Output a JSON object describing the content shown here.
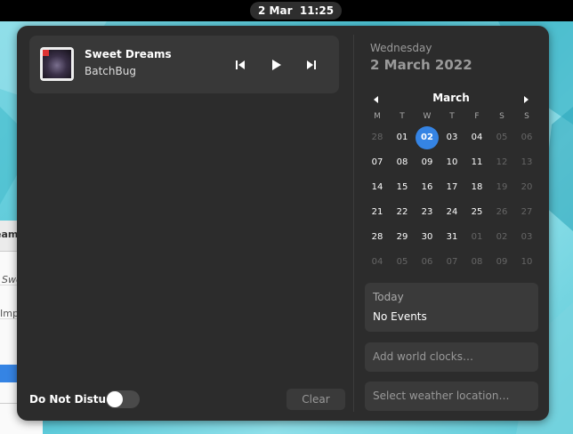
{
  "topbar": {
    "date": "2 Mar",
    "time": "11:25"
  },
  "background_window": {
    "fragments": [
      "eam",
      "Swe",
      "Imp"
    ]
  },
  "media": {
    "title": "Sweet Dreams",
    "artist": "BatchBug"
  },
  "notifications": {
    "dnd_label": "Do Not Disturb",
    "dnd_enabled": false,
    "clear_label": "Clear"
  },
  "calendar": {
    "weekday": "Wednesday",
    "full_date": "2 March 2022",
    "month": "March",
    "day_headers": [
      "M",
      "T",
      "W",
      "T",
      "F",
      "S",
      "S"
    ],
    "weeks": [
      [
        {
          "d": "28",
          "o": true
        },
        {
          "d": "01",
          "o": false
        },
        {
          "d": "02",
          "o": false,
          "t": true
        },
        {
          "d": "03",
          "o": false
        },
        {
          "d": "04",
          "o": false
        },
        {
          "d": "05",
          "o": false,
          "w": true
        },
        {
          "d": "06",
          "o": false,
          "w": true
        }
      ],
      [
        {
          "d": "07",
          "o": false
        },
        {
          "d": "08",
          "o": false
        },
        {
          "d": "09",
          "o": false
        },
        {
          "d": "10",
          "o": false
        },
        {
          "d": "11",
          "o": false
        },
        {
          "d": "12",
          "o": false,
          "w": true
        },
        {
          "d": "13",
          "o": false,
          "w": true
        }
      ],
      [
        {
          "d": "14",
          "o": false
        },
        {
          "d": "15",
          "o": false
        },
        {
          "d": "16",
          "o": false
        },
        {
          "d": "17",
          "o": false
        },
        {
          "d": "18",
          "o": false
        },
        {
          "d": "19",
          "o": false,
          "w": true
        },
        {
          "d": "20",
          "o": false,
          "w": true
        }
      ],
      [
        {
          "d": "21",
          "o": false
        },
        {
          "d": "22",
          "o": false
        },
        {
          "d": "23",
          "o": false
        },
        {
          "d": "24",
          "o": false
        },
        {
          "d": "25",
          "o": false
        },
        {
          "d": "26",
          "o": false,
          "w": true
        },
        {
          "d": "27",
          "o": false,
          "w": true
        }
      ],
      [
        {
          "d": "28",
          "o": false
        },
        {
          "d": "29",
          "o": false
        },
        {
          "d": "30",
          "o": false
        },
        {
          "d": "31",
          "o": false
        },
        {
          "d": "01",
          "o": true
        },
        {
          "d": "02",
          "o": true
        },
        {
          "d": "03",
          "o": true
        }
      ],
      [
        {
          "d": "04",
          "o": true
        },
        {
          "d": "05",
          "o": true
        },
        {
          "d": "06",
          "o": true
        },
        {
          "d": "07",
          "o": true
        },
        {
          "d": "08",
          "o": true
        },
        {
          "d": "09",
          "o": true
        },
        {
          "d": "10",
          "o": true
        }
      ]
    ]
  },
  "events": {
    "title": "Today",
    "body": "No Events"
  },
  "world_clocks": {
    "label": "Add world clocks…"
  },
  "weather": {
    "label": "Select weather location…"
  },
  "colors": {
    "accent": "#3584e4",
    "panel": "#2c2c2c",
    "card": "#3a3a3a"
  }
}
